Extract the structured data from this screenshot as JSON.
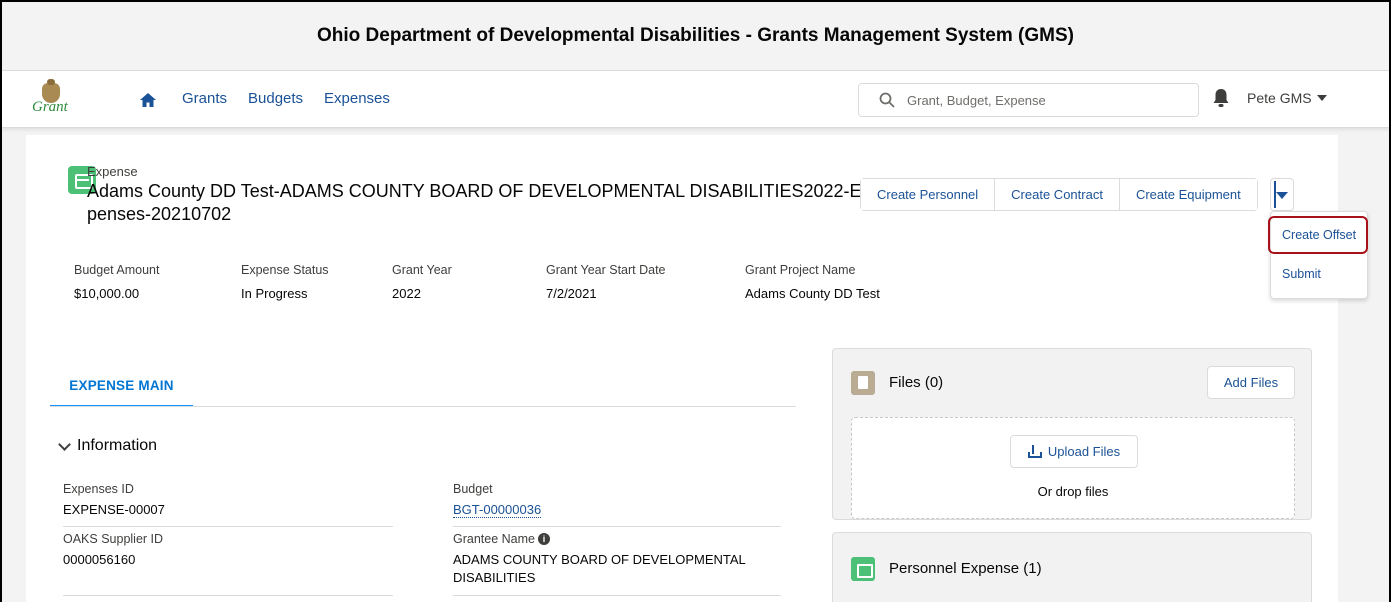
{
  "app": {
    "title": "Ohio Department of Developmental Disabilities - Grants Management System (GMS)",
    "logo_text": "Grant"
  },
  "nav": {
    "links": [
      "Grants",
      "Budgets",
      "Expenses"
    ],
    "search_placeholder": "Grant, Budget, Expense",
    "user": "Pete GMS"
  },
  "record": {
    "object_label": "Expense",
    "title": "Adams County DD Test-ADAMS COUNTY BOARD OF DEVELOPMENTAL DISABILITIES2022-Ex-penses-20210702",
    "actions": [
      "Create Personnel",
      "Create Contract",
      "Create Equipment"
    ],
    "menu_items": [
      "Create Offset",
      "Submit"
    ]
  },
  "highlights": [
    {
      "label": "Budget Amount",
      "value": "$10,000.00"
    },
    {
      "label": "Expense Status",
      "value": "In Progress"
    },
    {
      "label": "Grant Year",
      "value": "2022"
    },
    {
      "label": "Grant Year Start Date",
      "value": "7/2/2021"
    },
    {
      "label": "Grant Project Name",
      "value": "Adams County DD Test"
    }
  ],
  "tabs": {
    "active": "EXPENSE MAIN"
  },
  "information": {
    "heading": "Information",
    "fields": {
      "expenses_id": {
        "label": "Expenses ID",
        "value": "EXPENSE-00007"
      },
      "budget": {
        "label": "Budget",
        "value": "BGT-00000036"
      },
      "oaks_supplier_id": {
        "label": "OAKS Supplier ID",
        "value": "0000056160"
      },
      "grantee_name": {
        "label": "Grantee Name",
        "value": "ADAMS COUNTY BOARD OF DEVELOPMENTAL DISABILITIES"
      }
    }
  },
  "related": {
    "files": {
      "title": "Files (0)",
      "add_label": "Add Files",
      "upload_label": "Upload Files",
      "drop_text": "Or drop files"
    },
    "personnel_expense": {
      "title": "Personnel Expense (1)"
    }
  },
  "colors": {
    "link": "#1b5297",
    "active_tab": "#0176d3",
    "record_icon": "#4bc076",
    "highlight_border": "#a8111a"
  }
}
